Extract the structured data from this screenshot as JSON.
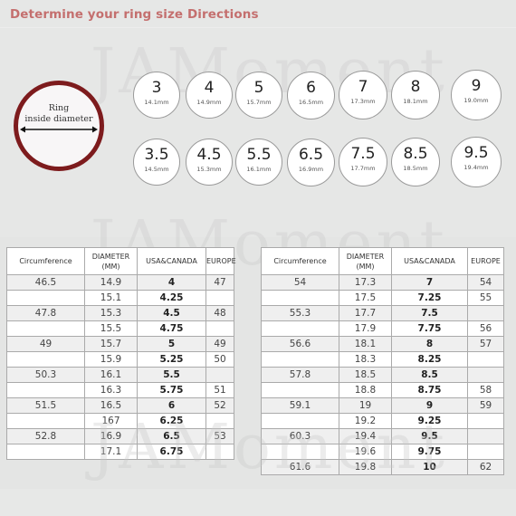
{
  "header": {
    "title": "Determine your ring size Directions"
  },
  "watermark": "JAMoment",
  "diagram": {
    "label_line1": "Ring",
    "label_line2": "inside diameter",
    "ring_color": "#7d1b1d"
  },
  "sizes_row1": [
    {
      "size": "3",
      "mm": "14.1mm"
    },
    {
      "size": "4",
      "mm": "14.9mm"
    },
    {
      "size": "5",
      "mm": "15.7mm"
    },
    {
      "size": "6",
      "mm": "16.5mm"
    },
    {
      "size": "7",
      "mm": "17.3mm"
    },
    {
      "size": "8",
      "mm": "18.1mm"
    },
    {
      "size": "9",
      "mm": "19.0mm"
    }
  ],
  "sizes_row2": [
    {
      "size": "3.5",
      "mm": "14.5mm"
    },
    {
      "size": "4.5",
      "mm": "15.3mm"
    },
    {
      "size": "5.5",
      "mm": "16.1mm"
    },
    {
      "size": "6.5",
      "mm": "16.9mm"
    },
    {
      "size": "7.5",
      "mm": "17.7mm"
    },
    {
      "size": "8.5",
      "mm": "18.5mm"
    },
    {
      "size": "9.5",
      "mm": "19.4mm"
    }
  ],
  "table": {
    "headers": [
      "Circumference",
      "DIAMETER (MM)",
      "USA&CANADA",
      "EUROPE"
    ],
    "left_rows": [
      [
        "46.5",
        "14.9",
        "4",
        "47"
      ],
      [
        "",
        "15.1",
        "4.25",
        ""
      ],
      [
        "47.8",
        "15.3",
        "4.5",
        "48"
      ],
      [
        "",
        "15.5",
        "4.75",
        ""
      ],
      [
        "49",
        "15.7",
        "5",
        "49"
      ],
      [
        "",
        "15.9",
        "5.25",
        "50"
      ],
      [
        "50.3",
        "16.1",
        "5.5",
        ""
      ],
      [
        "",
        "16.3",
        "5.75",
        "51"
      ],
      [
        "51.5",
        "16.5",
        "6",
        "52"
      ],
      [
        "",
        "167",
        "6.25",
        ""
      ],
      [
        "52.8",
        "16.9",
        "6.5",
        "53"
      ],
      [
        "",
        "17.1",
        "6.75",
        ""
      ]
    ],
    "right_rows": [
      [
        "54",
        "17.3",
        "7",
        "54"
      ],
      [
        "",
        "17.5",
        "7.25",
        "55"
      ],
      [
        "55.3",
        "17.7",
        "7.5",
        ""
      ],
      [
        "",
        "17.9",
        "7.75",
        "56"
      ],
      [
        "56.6",
        "18.1",
        "8",
        "57"
      ],
      [
        "",
        "18.3",
        "8.25",
        ""
      ],
      [
        "57.8",
        "18.5",
        "8.5",
        ""
      ],
      [
        "",
        "18.8",
        "8.75",
        "58"
      ],
      [
        "59.1",
        "19",
        "9",
        "59"
      ],
      [
        "",
        "19.2",
        "9.25",
        ""
      ],
      [
        "60.3",
        "19.4",
        "9.5",
        ""
      ],
      [
        "",
        "19.6",
        "9.75",
        ""
      ],
      [
        "61.6",
        "19.8",
        "10",
        "62"
      ]
    ]
  }
}
